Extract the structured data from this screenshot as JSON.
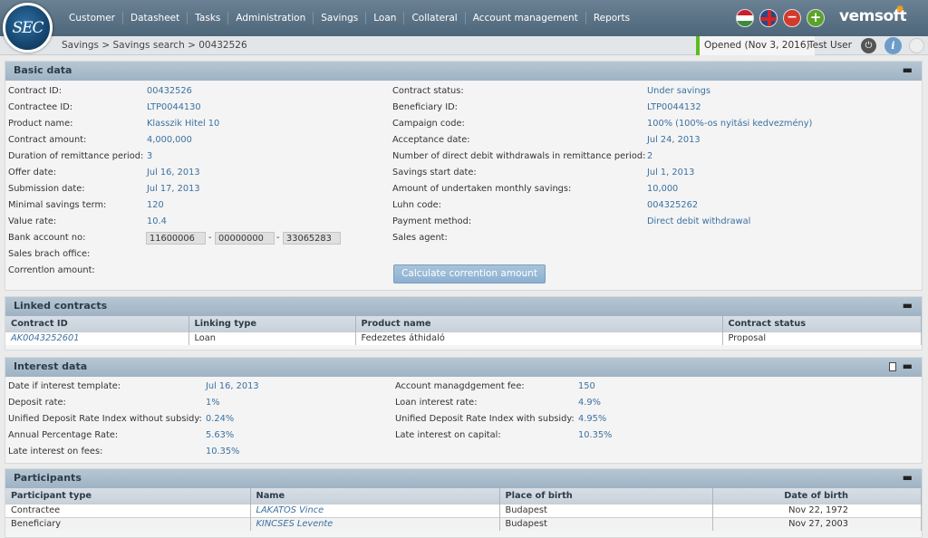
{
  "app": {
    "logo_text": "SEC",
    "brand": "vemsoft"
  },
  "menu": [
    "Customer",
    "Datasheet",
    "Tasks",
    "Administration",
    "Savings",
    "Loan",
    "Collateral",
    "Account management",
    "Reports"
  ],
  "breadcrumb": "Savings > Savings search > 00432526",
  "status": "Opened (Nov 3, 2016)",
  "user": "Test User",
  "basic": {
    "title": "Basic data",
    "left": [
      {
        "label": "Contract ID:",
        "value": "00432526"
      },
      {
        "label": "Contractee ID:",
        "value": "LTP0044130"
      },
      {
        "label": "Product name:",
        "value": "Klasszik Hitel 10"
      },
      {
        "label": "Contract amount:",
        "value": "4,000,000"
      },
      {
        "label": "Duration of remittance period:",
        "value": "3"
      },
      {
        "label": "Offer date:",
        "value": "Jul 16, 2013"
      },
      {
        "label": "Submission date:",
        "value": "Jul 17, 2013"
      },
      {
        "label": "Minimal savings term:",
        "value": "120"
      },
      {
        "label": "Value rate:",
        "value": "10.4"
      }
    ],
    "bank_label": "Bank account no:",
    "bank_parts": [
      "11600006",
      "00000000",
      "33065283"
    ],
    "sales_office_label": "Sales brach office:",
    "corr_label": "Correntlon amount:",
    "right": [
      {
        "label": "Contract status:",
        "value": "Under savings"
      },
      {
        "label": "Beneficiary ID:",
        "value": "LTP0044132"
      },
      {
        "label": "Campaign code:",
        "value": "100% (100%-os nyitási kedvezmény)"
      },
      {
        "label": "Acceptance date:",
        "value": "Jul 24, 2013"
      },
      {
        "label": "Number of direct debit withdrawals in remittance period:",
        "value": "2"
      },
      {
        "label": "Savings start date:",
        "value": "Jul 1, 2013"
      },
      {
        "label": "Amount of undertaken monthly savings:",
        "value": "10,000"
      },
      {
        "label": "Luhn code:",
        "value": "004325262"
      },
      {
        "label": "Payment method:",
        "value": "Direct debit withdrawal"
      },
      {
        "label": "Sales agent:",
        "value": ""
      }
    ],
    "calc_button": "Calculate corrention amount"
  },
  "linked": {
    "title": "Linked contracts",
    "headers": [
      "Contract ID",
      "Linking type",
      "Product name",
      "Contract status"
    ],
    "rows": [
      [
        "AK0043252601",
        "Loan",
        "Fedezetes áthidaló",
        "Proposal"
      ]
    ]
  },
  "interest": {
    "title": "Interest data",
    "left": [
      {
        "label": "Date if interest template:",
        "value": "Jul 16, 2013"
      },
      {
        "label": "Deposit rate:",
        "value": "1%"
      },
      {
        "label": "Unified Deposit Rate Index without subsidy:",
        "value": "0.24%"
      },
      {
        "label": "Annual Percentage Rate:",
        "value": "5.63%"
      },
      {
        "label": "Late interest on fees:",
        "value": "10.35%"
      }
    ],
    "right": [
      {
        "label": "Account managdgement fee:",
        "value": "150"
      },
      {
        "label": "Loan interest rate:",
        "value": "4.9%"
      },
      {
        "label": "Unified Deposit Rate Index with subsidy:",
        "value": "4.95%"
      },
      {
        "label": "Late interest on capital:",
        "value": "10.35%"
      }
    ]
  },
  "participants": {
    "title": "Participants",
    "headers": [
      "Participant type",
      "Name",
      "Place of birth",
      "Date of birth"
    ],
    "rows": [
      [
        "Contractee",
        "LAKATOS Vince",
        "Budapest",
        "Nov 22, 1972"
      ],
      [
        "Beneficiary",
        "KINCSES Levente",
        "Budapest",
        "Nov 27, 2003"
      ]
    ]
  }
}
